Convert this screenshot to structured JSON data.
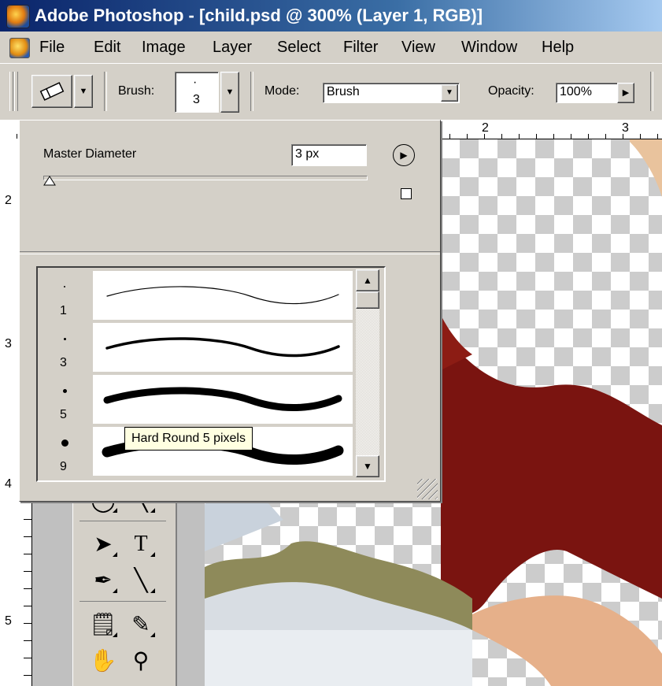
{
  "window": {
    "title": "Adobe Photoshop - [child.psd @ 300% (Layer 1, RGB)]",
    "app_icon": "photoshop-icon"
  },
  "menu": {
    "doc_icon": "document-icon",
    "items": [
      "File",
      "Edit",
      "Image",
      "Layer",
      "Select",
      "Filter",
      "View",
      "Window",
      "Help"
    ]
  },
  "options_bar": {
    "tool_icon": "eraser-icon",
    "brush_label": "Brush:",
    "brush_dot": "·",
    "brush_size": "3",
    "mode_label": "Mode:",
    "mode_value": "Brush",
    "opacity_label": "Opacity:",
    "opacity_value": "100%"
  },
  "rulers": {
    "top_numbers": [
      "2",
      "3"
    ],
    "left_numbers": [
      "2",
      "3",
      "4",
      "5"
    ]
  },
  "brush_panel": {
    "master_diameter_label": "Master Diameter",
    "master_diameter_value": "3 px",
    "slider_value": 3,
    "brushes": [
      {
        "dot": "·",
        "size": "1",
        "stroke_width": 1.2
      },
      {
        "dot": "·",
        "size": "3",
        "stroke_width": 3.5
      },
      {
        "dot": "•",
        "size": "5",
        "stroke_width": 9
      },
      {
        "dot": "●",
        "size": "9",
        "stroke_width": 13
      }
    ],
    "tooltip": "Hard Round 5 pixels"
  },
  "colors": {
    "title_start": "#0a246a",
    "title_end": "#a6caf0",
    "chrome": "#d4d0c8",
    "tooltip_bg": "#ffffe1",
    "photo_red": "#7a1410"
  }
}
